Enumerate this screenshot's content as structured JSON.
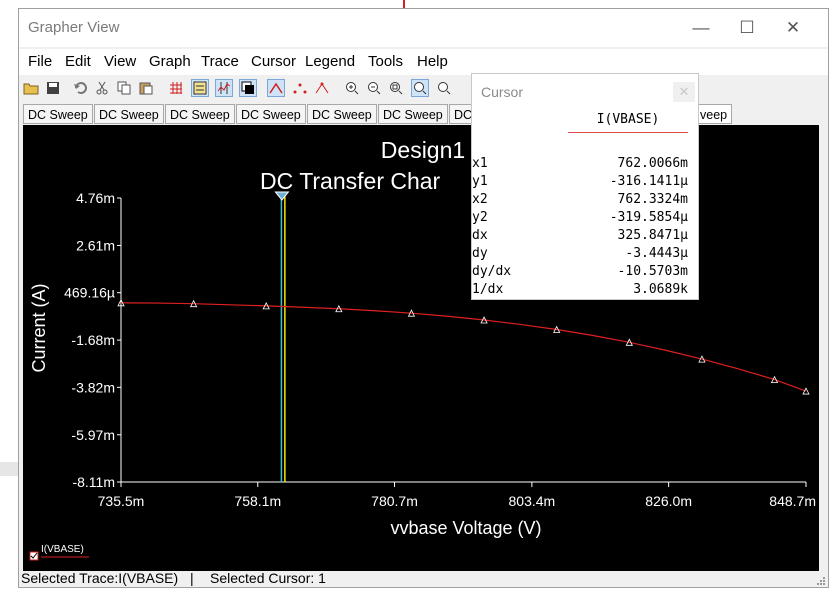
{
  "window": {
    "title": "Grapher View"
  },
  "window_controls": {
    "minimize_icon": "minimize-icon",
    "maximize_icon": "maximize-icon",
    "close_icon": "close-icon"
  },
  "menu": [
    {
      "label": "File"
    },
    {
      "label": "Edit"
    },
    {
      "label": "View"
    },
    {
      "label": "Graph"
    },
    {
      "label": "Trace"
    },
    {
      "label": "Cursor"
    },
    {
      "label": "Legend"
    },
    {
      "label": "Tools"
    },
    {
      "label": "Help"
    }
  ],
  "toolbar": {
    "icons": [
      "open-icon",
      "save-icon",
      "undo-icon",
      "cut-icon",
      "copy-icon",
      "paste-icon",
      "grid-icon",
      "legend-icon",
      "cursors-icon",
      "reverse-colors-icon",
      "show-lines-icon",
      "show-markers-icon",
      "lines-markers-icon",
      "zoom-in-icon",
      "zoom-out-icon",
      "zoom-area-icon",
      "zoom-full-icon",
      "print-icon"
    ]
  },
  "tabs": [
    {
      "label": "DC Sweep"
    },
    {
      "label": "DC Sweep"
    },
    {
      "label": "DC Sweep"
    },
    {
      "label": "DC Sweep"
    },
    {
      "label": "DC Sweep"
    },
    {
      "label": "DC Sweep"
    },
    {
      "label": "DC"
    },
    {
      "label": "veep"
    }
  ],
  "status": {
    "selected_trace": "Selected Trace:I(VBASE)",
    "separator": "|",
    "selected_cursor": "Selected Cursor: 1"
  },
  "cursor_panel": {
    "title": "Cursor",
    "column": "I(VBASE)",
    "rows": [
      {
        "key": "x1",
        "value": "762.0066m"
      },
      {
        "key": "y1",
        "value": "-316.1411µ"
      },
      {
        "key": "x2",
        "value": "762.3324m"
      },
      {
        "key": "y2",
        "value": "-319.5854µ"
      },
      {
        "key": "dx",
        "value": "325.8471µ"
      },
      {
        "key": "dy",
        "value": "-3.4443µ"
      },
      {
        "key": "dy/dx",
        "value": "-10.5703m"
      },
      {
        "key": "1/dx",
        "value": "3.0689k"
      }
    ]
  },
  "chart_data": {
    "type": "line",
    "title": "Design1",
    "subtitle": "DC Transfer Char",
    "xlabel": "vvbase Voltage (V)",
    "ylabel": "Current (A)",
    "x_tick_labels": [
      "735.5m",
      "758.1m",
      "780.7m",
      "803.4m",
      "826.0m",
      "848.7m"
    ],
    "x_ticks": [
      0.7355,
      0.7581,
      0.7807,
      0.8034,
      0.826,
      0.8487
    ],
    "y_tick_labels": [
      "4.76m",
      "2.61m",
      "469.16µ",
      "-1.68m",
      "-3.82m",
      "-5.97m",
      "-8.11m"
    ],
    "y_ticks": [
      0.00476,
      0.00261,
      0.00046916,
      -0.00168,
      -0.00382,
      -0.00597,
      -0.00811
    ],
    "xlim": [
      0.7355,
      0.8487
    ],
    "ylim": [
      -0.00811,
      0.00476
    ],
    "grid": false,
    "cursor_x": [
      0.7620066,
      0.7623324
    ],
    "series": [
      {
        "name": "I(VBASE)",
        "color": "#e02020",
        "x": [
          0.7355,
          0.7415,
          0.7475,
          0.7535,
          0.7595,
          0.7655,
          0.7715,
          0.7775,
          0.7835,
          0.7895,
          0.7955,
          0.8015,
          0.8075,
          0.8135,
          0.8195,
          0.8255,
          0.8315,
          0.8375,
          0.8435,
          0.8487
        ],
        "y": [
          1e-05,
          0.0,
          -3e-05,
          -8e-05,
          -0.00013,
          -0.00019,
          -0.00026,
          -0.00035,
          -0.00046,
          -0.0006,
          -0.00077,
          -0.00097,
          -0.0012,
          -0.00147,
          -0.00178,
          -0.00214,
          -0.00254,
          -0.00298,
          -0.00347,
          -0.00399
        ]
      }
    ],
    "legend": {
      "placement": "bottom-left",
      "label": "I(VBASE)"
    }
  }
}
